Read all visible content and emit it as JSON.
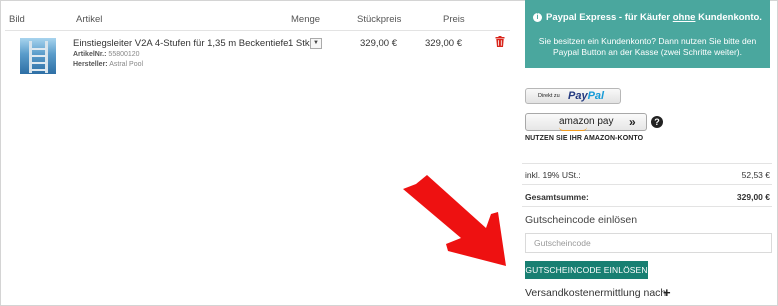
{
  "cart": {
    "headers": {
      "image": "Bild",
      "article": "Artikel",
      "quantity": "Menge",
      "unit_price": "Stückpreis",
      "price": "Preis"
    },
    "item": {
      "name": "Einstiegsleiter V2A 4-Stufen für 1,35 m Beckentiefe",
      "article_no_label": "ArtikelNr.:",
      "article_no": "55800120",
      "manufacturer_label": "Hersteller:",
      "manufacturer": "Astral Pool",
      "quantity": "1 Stk.",
      "unit_price": "329,00 €",
      "price": "329,00 €",
      "image_icon": "pool-ladder-image",
      "delete_icon": "trash-icon"
    }
  },
  "paypal_express": {
    "title_prefix": "Paypal Express - für Käufer",
    "title_underlined": "ohne",
    "title_suffix": "Kundenkonto.",
    "info_icon": "info-icon",
    "text": "Sie besitzen ein Kundenkonto? Dann nutzen Sie bitte den Paypal Button an der Kasse (zwei Schritte weiter).",
    "bg_color": "#4aa79e"
  },
  "paypal_button": {
    "small": "Direkt zu",
    "logo_1": "Pay",
    "logo_2": "Pal"
  },
  "amazon_button": {
    "logo": "amazon pay",
    "chevron": "»",
    "help": "?",
    "note": "NUTZEN SIE IHR AMAZON-KONTO"
  },
  "summary": {
    "vat_label": "inkl. 19% USt.:",
    "vat_value": "52,53 €",
    "total_label": "Gesamtsumme:",
    "total_value": "329,00 €"
  },
  "voucher": {
    "title": "Gutscheincode einlösen",
    "placeholder": "Gutscheincode",
    "button_label": "GUTSCHEINCODE EINLÖSEN",
    "button_color": "#187f72"
  },
  "shipping": {
    "label": "Versandkostenermittlung nach",
    "icon": "plus-icon"
  },
  "annotation": {
    "arrow_color": "#ee1111",
    "arrow_icon": "red-arrow-icon"
  }
}
